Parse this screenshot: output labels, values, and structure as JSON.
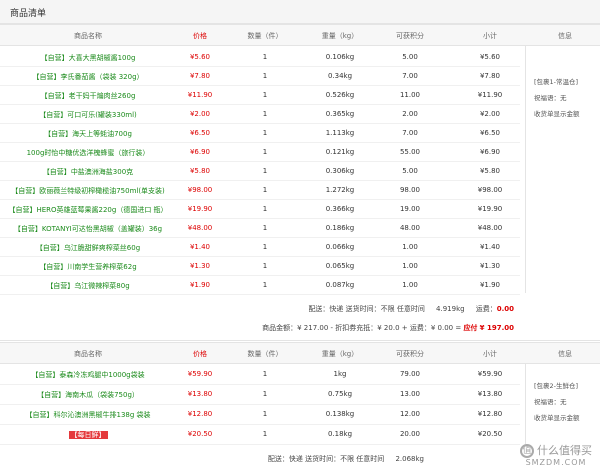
{
  "title": "商品清单",
  "columns": {
    "name": "商品名称",
    "price": "价格",
    "qty": "数量（件）",
    "weight": "重量（kg）",
    "points": "可获积分",
    "subtotal": "小计",
    "info": "信息"
  },
  "package1": {
    "items": [
      {
        "tag": "【自营】",
        "name": "大喜大黑胡椒酱100g",
        "price": "¥5.60",
        "qty": "1",
        "weight": "0.106kg",
        "points": "5.00",
        "subtotal": "¥5.60"
      },
      {
        "tag": "【自营】",
        "name": "李氏番茄酱（袋装 320g）",
        "price": "¥7.80",
        "qty": "1",
        "weight": "0.34kg",
        "points": "7.00",
        "subtotal": "¥7.80"
      },
      {
        "tag": "【自营】",
        "name": "老干妈干煸肉丝260g",
        "price": "¥11.90",
        "qty": "1",
        "weight": "0.526kg",
        "points": "11.00",
        "subtotal": "¥11.90"
      },
      {
        "tag": "【自营】",
        "name": "可口可乐(罐装330ml)",
        "price": "¥2.00",
        "qty": "1",
        "weight": "0.365kg",
        "points": "2.00",
        "subtotal": "¥2.00"
      },
      {
        "tag": "【自营】",
        "name": "海天上等蚝油700g",
        "price": "¥6.50",
        "qty": "1",
        "weight": "1.113kg",
        "points": "7.00",
        "subtotal": "¥6.50"
      },
      {
        "tag": "",
        "name": "100g时怡中糖优选洋槐蜂蜜（旅行装）",
        "price": "¥6.90",
        "qty": "1",
        "weight": "0.121kg",
        "points": "55.00",
        "subtotal": "¥6.90"
      },
      {
        "tag": "【自营】",
        "name": "中盐澳洲海盐300克",
        "price": "¥5.80",
        "qty": "1",
        "weight": "0.306kg",
        "points": "5.00",
        "subtotal": "¥5.80"
      },
      {
        "tag": "【自营】",
        "name": "欧丽薇兰特级初榨橄榄油750ml(单支装)",
        "price": "¥98.00",
        "qty": "1",
        "weight": "1.272kg",
        "points": "98.00",
        "subtotal": "¥98.00"
      },
      {
        "tag": "【自营】",
        "name": "HERO英雄蓝莓果酱220g（德国进口 瓶）",
        "price": "¥19.90",
        "qty": "1",
        "weight": "0.366kg",
        "points": "19.00",
        "subtotal": "¥19.90"
      },
      {
        "tag": "【自营】",
        "name": "KOTANYI可达怡黑胡椒（盖罐装）36g",
        "price": "¥48.00",
        "qty": "1",
        "weight": "0.186kg",
        "points": "48.00",
        "subtotal": "¥48.00"
      },
      {
        "tag": "【自营】",
        "name": "乌江脆甜鲜爽榨菜丝60g",
        "price": "¥1.40",
        "qty": "1",
        "weight": "0.066kg",
        "points": "1.00",
        "subtotal": "¥1.40"
      },
      {
        "tag": "【自营】",
        "name": "川南学生营养榨菜62g",
        "price": "¥1.30",
        "qty": "1",
        "weight": "0.065kg",
        "points": "1.00",
        "subtotal": "¥1.30"
      },
      {
        "tag": "【自营】",
        "name": "乌江微辣榨菜80g",
        "price": "¥1.90",
        "qty": "1",
        "weight": "0.087kg",
        "points": "1.00",
        "subtotal": "¥1.90"
      }
    ],
    "info": {
      "line1": "[包裹1-常温仓]",
      "line2": "祝福语：无",
      "line3": "收货单显示金额"
    },
    "shipping_line": "配送：快递 送货时间：不限 任意时间",
    "total_weight": "4.919kg",
    "freight_label": "运费：",
    "freight_value": "0.00",
    "amount_line": "商品金额：¥ 217.00 - 折扣券充抵：¥ 20.0 + 运费：¥ 0.00 =",
    "payable_label": "应付",
    "payable_value": "¥ 197.00"
  },
  "package2": {
    "items": [
      {
        "tag": "【自营】",
        "name": "泰森冷冻鸡腿中1000g袋装",
        "price": "¥59.90",
        "qty": "1",
        "weight": "1kg",
        "points": "79.00",
        "subtotal": "¥59.90"
      },
      {
        "tag": "【自营】",
        "name": "海南木瓜（袋装750g）",
        "price": "¥13.80",
        "qty": "1",
        "weight": "0.75kg",
        "points": "13.00",
        "subtotal": "¥13.80"
      },
      {
        "tag": "【自营】",
        "name": "科尔沁澳洲黑椒牛排138g 袋装",
        "price": "¥12.80",
        "qty": "1",
        "weight": "0.138kg",
        "points": "12.00",
        "subtotal": "¥12.80"
      },
      {
        "tag": "【每日鲜】",
        "name": "",
        "price": "¥20.50",
        "qty": "1",
        "weight": "0.18kg",
        "points": "20.00",
        "subtotal": "¥20.50"
      }
    ],
    "info": {
      "line1": "[包裹2-生鲜仓]",
      "line2": "祝福语：无",
      "line3": "收货单显示金额"
    },
    "shipping_line": "配送：快递 送货时间：不限 任意时间",
    "total_weight": "2.068kg"
  },
  "watermark": {
    "big": "什么值得买",
    "small": "SMZDM.COM"
  }
}
